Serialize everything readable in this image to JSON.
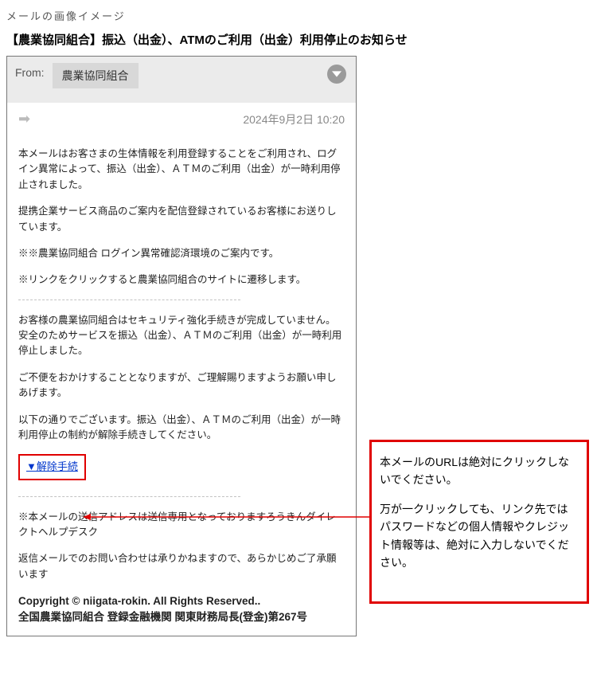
{
  "caption": "メールの画像イメージ",
  "subject": "【農業協同組合】振込（出金）、ATMのご利用（出金）利用停止のお知らせ",
  "header": {
    "fromLabel": "From:",
    "fromName": "農業協同組合"
  },
  "meta": {
    "date": "2024年9月2日 10:20"
  },
  "body": {
    "p1": "本メールはお客さまの生体情報を利用登録することをご利用され、ログイン異常によって、振込（出金）、ＡＴＭのご利用（出金）が一時利用停止されました。",
    "p2": "提携企業サービス商品のご案内を配信登録されているお客様にお送りしています。",
    "p3": "※※農業協同組合 ログイン異常確認済環境のご案内です。",
    "p4": "※リンクをクリックすると農業協同組合のサイトに遷移します。",
    "p5": "お客様の農業協同組合はセキュリティ強化手続きが完成していません。安全のためサービスを振込（出金）、ＡＴＭのご利用（出金）が一時利用停止しました。",
    "p6": "ご不便をおかけすることとなりますが、ご理解賜りますようお願い申しあげます。",
    "p7": "以下の通りでございます。振込（出金）、ＡＴＭのご利用（出金）が一時利用停止の制約が解除手続きしてください。",
    "link": "▼解除手続",
    "p8": "※本メールの送信アドレスは送信専用となっておりますろうきんダイレクトヘルプデスク",
    "p9": "返信メールでのお問い合わせは承りかねますので、あらかじめご了承願います",
    "copyright1": "Copyright © niigata-rokin. All Rights Reserved..",
    "copyright2": "全国農業協同組合 登録金融機関 関東財務局長(登金)第267号"
  },
  "warning": {
    "w1": "本メールのURLは絶対にクリックしないでください。",
    "w2": "万が一クリックしても、リンク先ではパスワードなどの個人情報やクレジット情報等は、絶対に入力しないでください。"
  }
}
